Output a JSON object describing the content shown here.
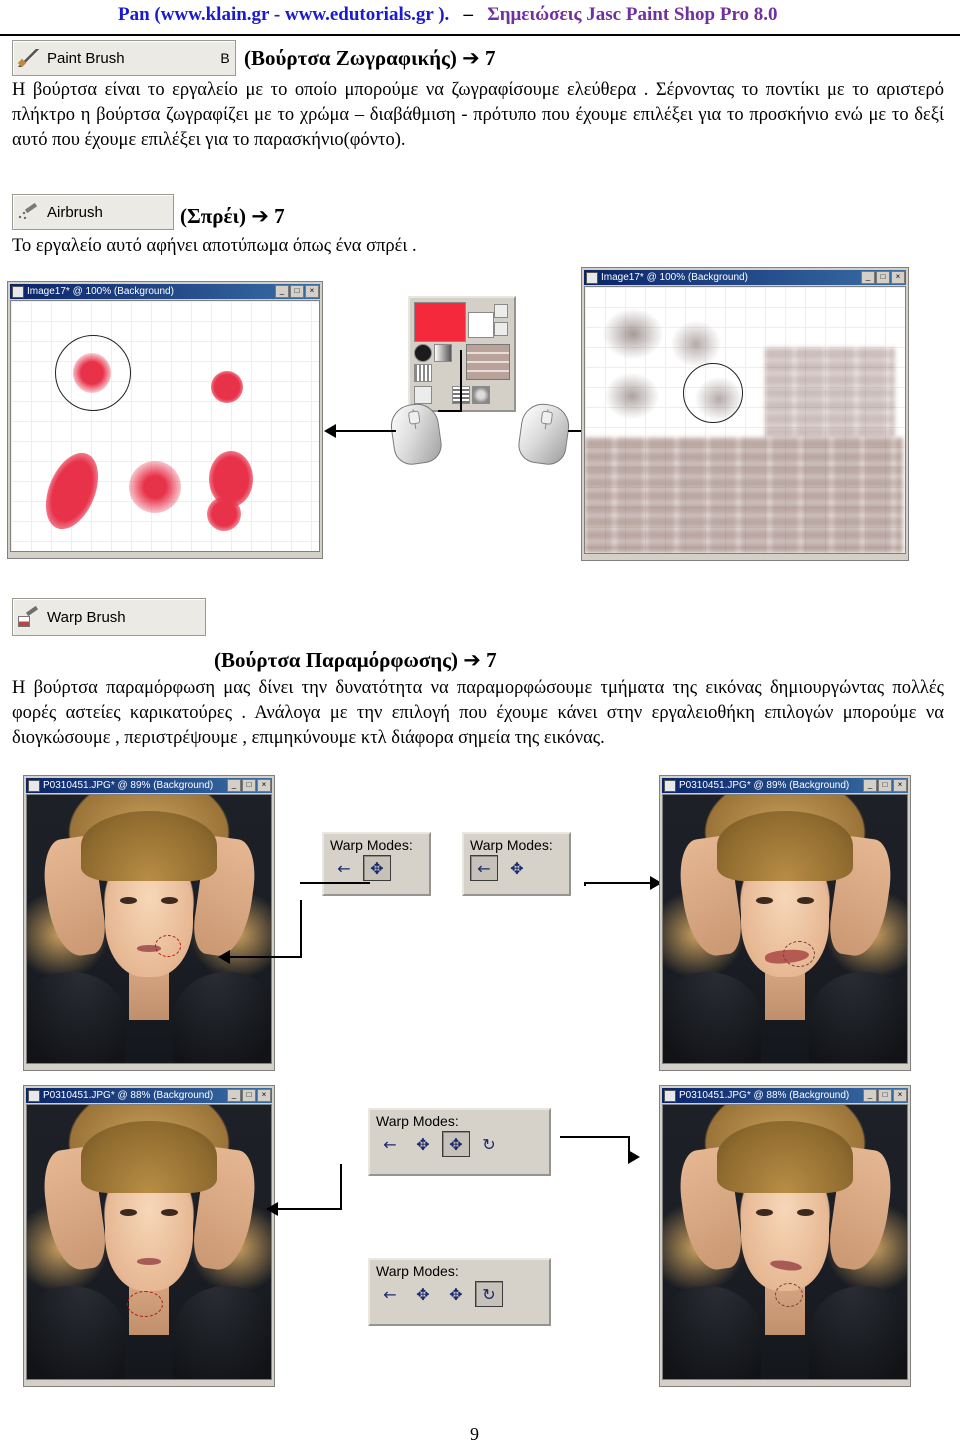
{
  "header": {
    "site": "Pan (www.klain.gr  -  www.edutorials.gr ).",
    "subject": "Σημειώσεις Jasc Paint Shop Pro 8.0"
  },
  "tools": {
    "paint_brush": {
      "label": "Paint Brush",
      "shortcut": "B",
      "icon": "paint-brush-icon"
    },
    "airbrush": {
      "label": "Airbrush",
      "shortcut": "",
      "icon": "airbrush-icon"
    },
    "warp_brush": {
      "label": "Warp Brush",
      "shortcut": "",
      "icon": "warp-brush-icon"
    }
  },
  "sections": [
    {
      "title": "(Βούρτσα Ζωγραφικής)",
      "arrow": "➔",
      "number": "7",
      "body": "Η βούρτσα είναι το εργαλείο με το οποίο μπορούμε να ζωγραφίσουμε ελεύθερα . Σέρνοντας το ποντίκι με το αριστερό πλήκτρο η βούρτσα ζωγραφίζει με το χρώμα – διαβάθμιση - πρότυπο που έχουμε επιλέξει για το προσκήνιο ενώ με το δεξί αυτό που έχουμε επιλέξει για το παρασκήνιο(φόντο)."
    },
    {
      "title": "(Σπρέι)",
      "arrow": "➔",
      "number": "7",
      "body": "Το εργαλείο αυτό αφήνει αποτύπωμα όπως ένα σπρέι ."
    },
    {
      "title": "(Βούρτσα Παραμόρφωσης)",
      "arrow": "➔",
      "number": "7",
      "body": "Η βούρτσα παραμόρφωση μας δίνει την δυνατότητα να παραμορφώσουμε τμήματα της εικόνας δημιουργώντας πολλές φορές αστείες καρικατούρες . Ανάλογα με την επιλογή που έχουμε κάνει στην εργαλειοθήκη επιλογών μπορούμε να διογκώσουμε , περιστρέψουμε , επιμηκύνουμε κτλ διάφορα σημεία της εικόνας."
    }
  ],
  "windows": {
    "brush_left": {
      "title": "Image17* @ 100% (Background)",
      "buttons": [
        "_",
        "□",
        "×"
      ]
    },
    "airbrush_right": {
      "title": "Image17* @ 100% (Background)",
      "buttons": [
        "_",
        "□",
        "×"
      ]
    },
    "warp_a": {
      "title": "P0310451.JPG* @ 89% (Background)",
      "buttons": [
        "_",
        "□",
        "×"
      ]
    },
    "warp_b": {
      "title": "P0310451.JPG* @ 89% (Background)",
      "buttons": [
        "_",
        "□",
        "×"
      ]
    },
    "warp_c": {
      "title": "P0310451.JPG* @ 88% (Background)",
      "buttons": [
        "_",
        "□",
        "×"
      ]
    },
    "warp_d": {
      "title": "P0310451.JPG* @ 88% (Background)",
      "buttons": [
        "_",
        "□",
        "×"
      ]
    }
  },
  "warp_bars": [
    {
      "label": "Warp Modes:",
      "buttons": [
        "←",
        "✥"
      ],
      "selected_index": 1
    },
    {
      "label": "Warp Modes:",
      "buttons": [
        "←",
        "✥"
      ],
      "selected_index": 0
    },
    {
      "label": "Warp Modes:",
      "buttons": [
        "←",
        "✥",
        "✥",
        "↻"
      ],
      "selected_index": 2
    },
    {
      "label": "Warp Modes:",
      "buttons": [
        "←",
        "✥",
        "✥",
        "↻"
      ],
      "selected_index": 3
    }
  ],
  "colors": {
    "header_link": "#1a1ad0",
    "header_subject": "#7030a0",
    "swatch_foreground": "#f4293c",
    "swatch_background": "#ffffff",
    "stroke_red": "#e8324a",
    "titlebar": "#0a246a"
  },
  "page_number": "9"
}
